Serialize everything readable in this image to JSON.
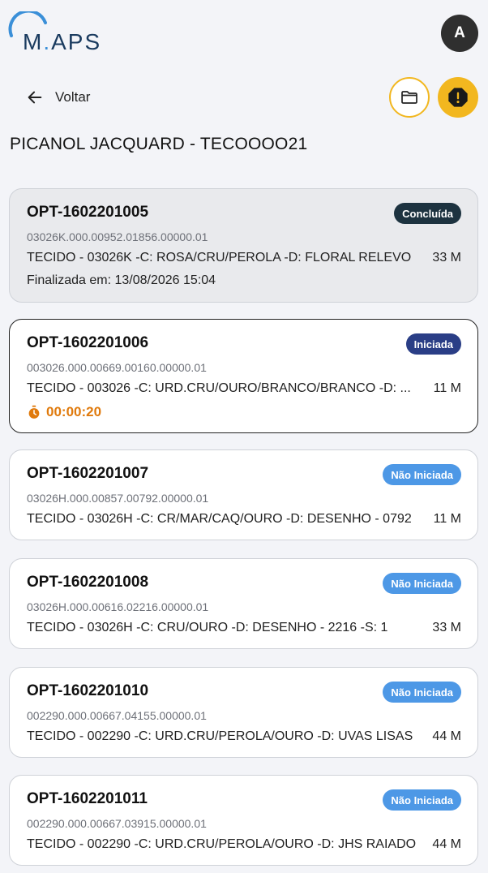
{
  "app": {
    "logo_text": "M",
    "logo_text_2": "APS",
    "avatar_initial": "A"
  },
  "nav": {
    "back_label": "Voltar"
  },
  "page": {
    "title": "PICANOL JACQUARD - TECOOOO21"
  },
  "colors": {
    "accent": "#f2b71f",
    "badge_done": "#1d3340",
    "badge_started": "#2a3e86",
    "badge_not_started": "#4d98e6",
    "timer": "#e07a0c"
  },
  "orders": [
    {
      "title": "OPT-1602201005",
      "status": "Concluída",
      "code": "03026K.000.00952.01856.00000.01",
      "description": "TECIDO - 03026K -C: ROSA/CRU/PEROLA -D: FLORAL RELEVO",
      "quantity": "33 M",
      "finished": "Finalizada em: 13/08/2026 15:04"
    },
    {
      "title": "OPT-1602201006",
      "status": "Iniciada",
      "code": "003026.000.00669.00160.00000.01",
      "description": "TECIDO - 003026 -C: URD.CRU/OURO/BRANCO/BRANCO -D: ...",
      "quantity": "11 M",
      "timer": "00:00:20"
    },
    {
      "title": "OPT-1602201007",
      "status": "Não Iniciada",
      "code": "03026H.000.00857.00792.00000.01",
      "description": "TECIDO - 03026H -C: CR/MAR/CAQ/OURO -D: DESENHO - 0792",
      "quantity": "11 M"
    },
    {
      "title": "OPT-1602201008",
      "status": "Não Iniciada",
      "code": "03026H.000.00616.02216.00000.01",
      "description": "TECIDO - 03026H -C: CRU/OURO -D: DESENHO - 2216 -S: 1",
      "quantity": "33 M"
    },
    {
      "title": "OPT-1602201010",
      "status": "Não Iniciada",
      "code": "002290.000.00667.04155.00000.01",
      "description": "TECIDO - 002290 -C: URD.CRU/PEROLA/OURO -D: UVAS LISAS",
      "quantity": "44 M"
    },
    {
      "title": "OPT-1602201011",
      "status": "Não Iniciada",
      "code": "002290.000.00667.03915.00000.01",
      "description": "TECIDO - 002290 -C: URD.CRU/PEROLA/OURO -D: JHS RAIADO",
      "quantity": "44 M"
    }
  ]
}
